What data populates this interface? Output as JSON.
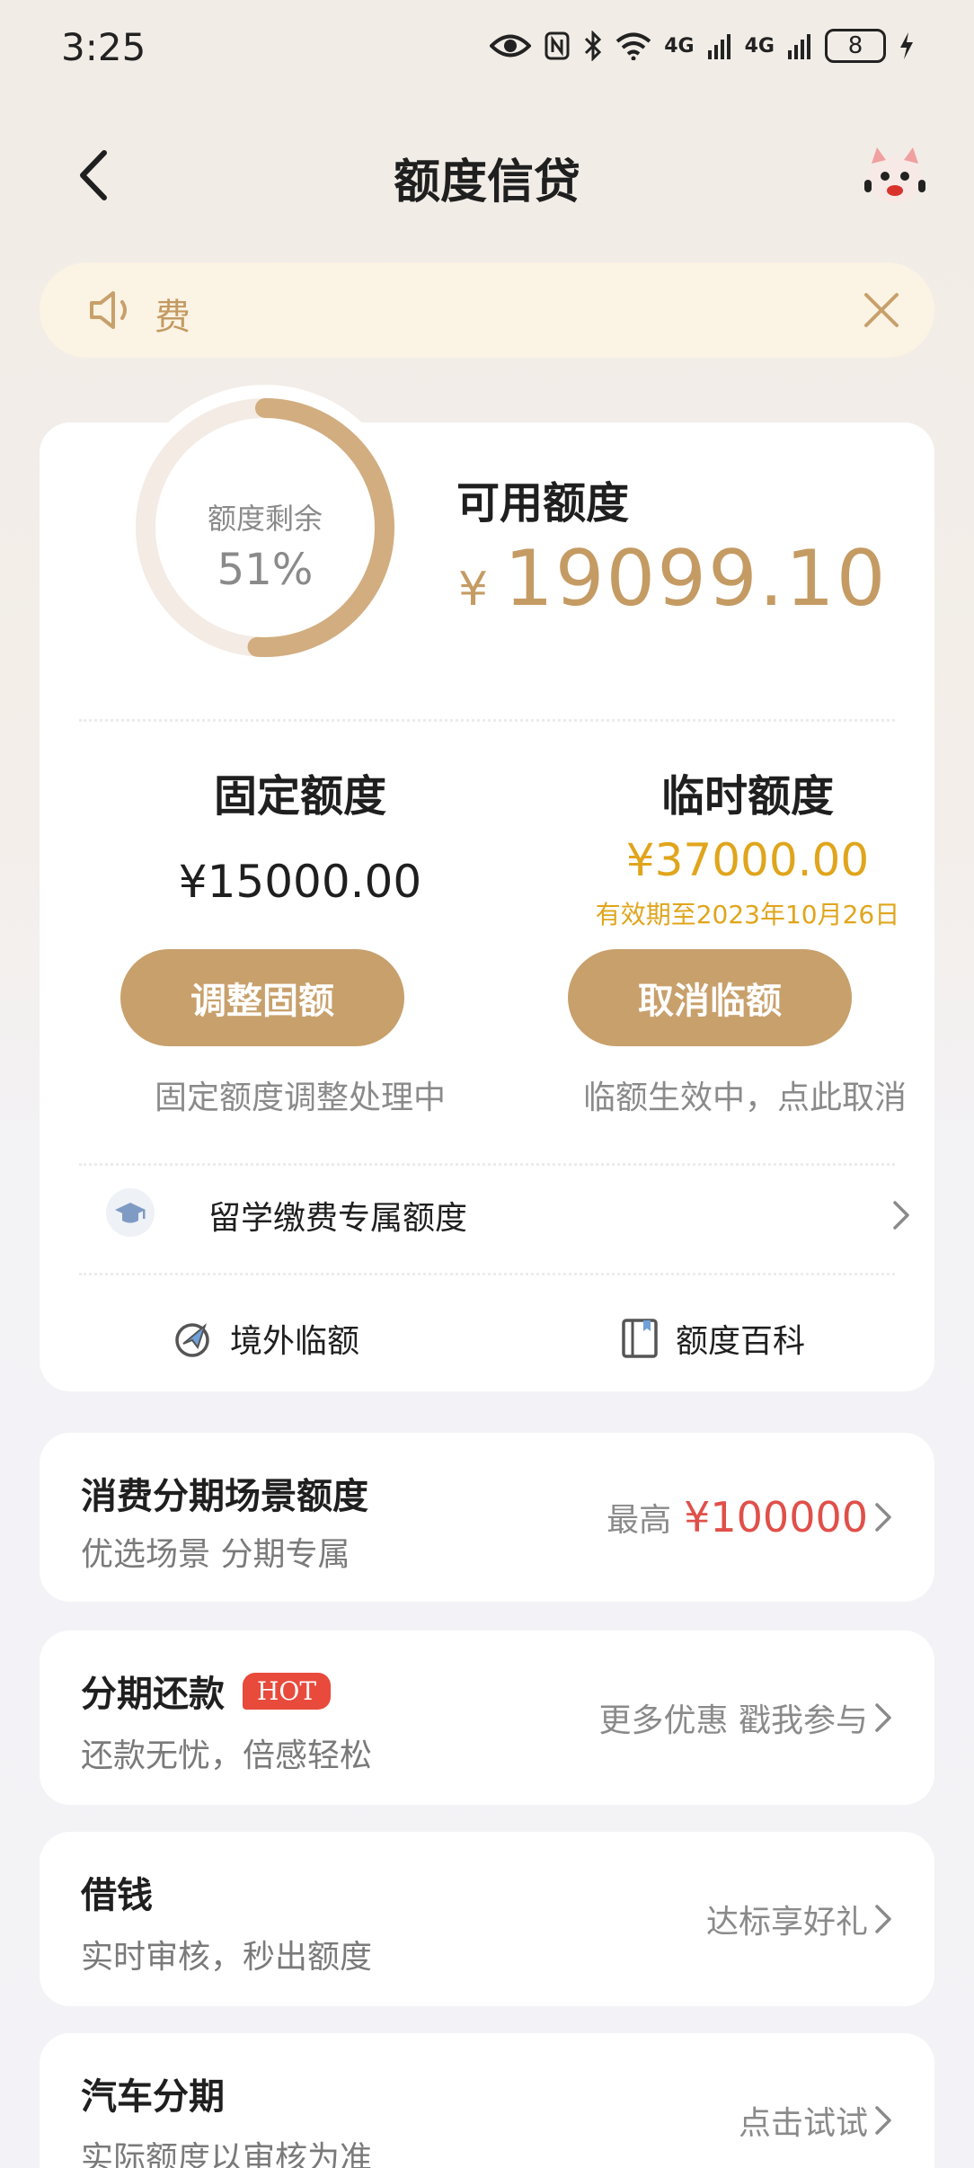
{
  "status_bar": {
    "time": "3:25",
    "battery": "8",
    "net1": "4G",
    "net2": "4G"
  },
  "nav": {
    "title": "额度信贷"
  },
  "notice": {
    "text": "费"
  },
  "credit": {
    "gauge_label": "额度剩余",
    "gauge_percent": "51%",
    "remaining_fraction": 0.51,
    "available_label": "可用额度",
    "currency": "¥",
    "available_amount": "19099.10",
    "fixed": {
      "title": "固定额度",
      "amount": "¥15000.00",
      "button": "调整固额",
      "status": "固定额度调整处理中"
    },
    "temporary": {
      "title": "临时额度",
      "amount": "¥37000.00",
      "expiry": "有效期至2023年10月26日",
      "button": "取消临额",
      "status": "临额生效中，点此取消"
    },
    "study_label": "留学缴费专属额度",
    "overseas_label": "境外临额",
    "encyclopedia_label": "额度百科"
  },
  "list": [
    {
      "title": "消费分期场景额度",
      "subtitle": "优选场景 分期专属",
      "right_prefix": "最高",
      "right_value": "¥100000"
    },
    {
      "title": "分期还款",
      "badge": "HOT",
      "subtitle": "还款无忧，倍感轻松",
      "right": "更多优惠 戳我参与"
    },
    {
      "title": "借钱",
      "subtitle": "实时审核，秒出额度",
      "right": "达标享好礼"
    },
    {
      "title": "汽车分期",
      "subtitle": "实际额度以审核为准",
      "right": "点击试试"
    }
  ],
  "colors": {
    "accent": "#c8a06c",
    "gold": "#e0a51c",
    "red": "#e0504a",
    "hot": "#e84a3c"
  }
}
